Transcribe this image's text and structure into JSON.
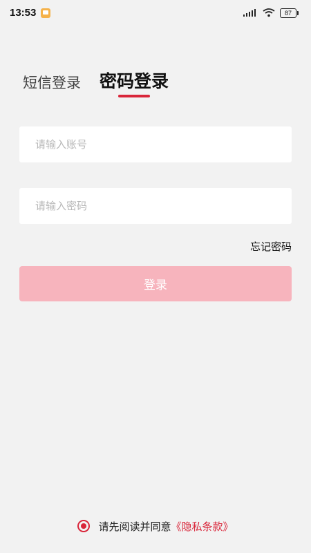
{
  "status_bar": {
    "time": "13:53",
    "battery": "87",
    "icons": [
      "notification-icon",
      "signal-icon",
      "wifi-icon",
      "battery-icon"
    ]
  },
  "tabs": [
    {
      "label": "短信登录",
      "active": false
    },
    {
      "label": "密码登录",
      "active": true
    }
  ],
  "form": {
    "account_placeholder": "请输入账号",
    "account_value": "",
    "password_placeholder": "请输入密码",
    "password_value": "",
    "forgot_label": "忘记密码",
    "login_label": "登录"
  },
  "agreement": {
    "text": "请先阅读并同意",
    "link": "《隐私条款》",
    "checked": true
  },
  "colors": {
    "accent": "#d9263a",
    "button_disabled": "#f7b4bd",
    "background": "#f2f2f2"
  }
}
